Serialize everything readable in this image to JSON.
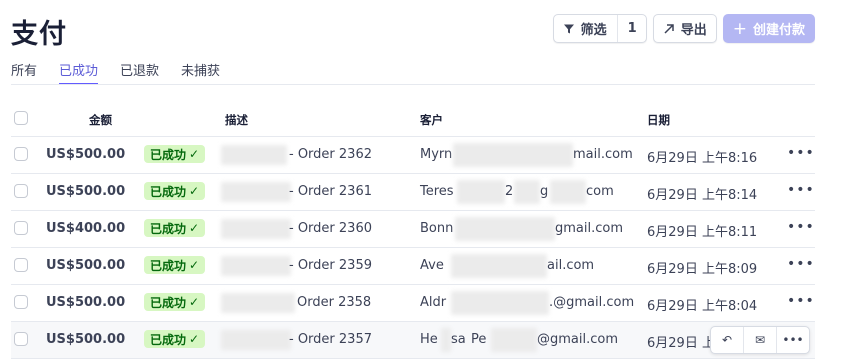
{
  "page": {
    "title": "支付"
  },
  "toolbar": {
    "filter_label": "筛选",
    "filter_count": "1",
    "export_label": "导出",
    "create_label": "创建付款"
  },
  "tabs": [
    {
      "label": "所有",
      "active": false
    },
    {
      "label": "已成功",
      "active": true
    },
    {
      "label": "已退款",
      "active": false
    },
    {
      "label": "未捕获",
      "active": false
    }
  ],
  "table": {
    "headers": {
      "amount": "金额",
      "description": "描述",
      "customer": "客户",
      "date": "日期"
    },
    "rows": [
      {
        "amount": "US$500.00",
        "status": "已成功",
        "description": "- Order 2362",
        "customer_a": "Myrn",
        "customer_b": "mail.com",
        "date": "6月29日 上午8:16"
      },
      {
        "amount": "US$500.00",
        "status": "已成功",
        "description": "- Order 2361",
        "customer_a": "Teres",
        "customer_b": "2",
        "customer_c": "g",
        "customer_d": "com",
        "date": "6月29日 上午8:14"
      },
      {
        "amount": "US$400.00",
        "status": "已成功",
        "description": "- Order 2360",
        "customer_a": "Bonn",
        "customer_b": "gmail.com",
        "date": "6月29日 上午8:11"
      },
      {
        "amount": "US$500.00",
        "status": "已成功",
        "description": "- Order 2359",
        "customer_a": "Ave",
        "customer_b": "ail.com",
        "date": "6月29日 上午8:09"
      },
      {
        "amount": "US$500.00",
        "status": "已成功",
        "description": "Order 2358",
        "customer_a": "Aldr",
        "customer_b": ".@gmail.com",
        "date": "6月29日 上午8:04"
      },
      {
        "amount": "US$500.00",
        "status": "已成功",
        "description": "- Order 2357",
        "customer_a": "He",
        "customer_b": "sa",
        "customer_c": "Pe",
        "customer_d": "@gmail.com",
        "date": "6月29日 上午8:"
      }
    ]
  },
  "colors": {
    "accent": "#635bff",
    "success_bg": "#d7f7c2",
    "success_fg": "#05690d"
  }
}
